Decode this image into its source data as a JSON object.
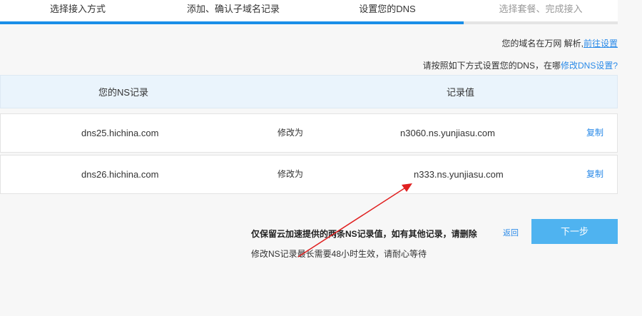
{
  "steps": [
    {
      "label": "选择接入方式",
      "state": "done"
    },
    {
      "label": "添加、确认子域名记录",
      "state": "done"
    },
    {
      "label": "设置您的DNS",
      "state": "current"
    },
    {
      "label": "选择套餐、完成接入",
      "state": "pending"
    }
  ],
  "progress": {
    "completed_steps": 3,
    "total_steps": 4,
    "color": "#1a8ee8"
  },
  "info": {
    "registrar_text": "您的域名在万网 解析,",
    "registrar_link": "前往设置",
    "instruction_text": "请按照如下方式设置您的DNS，在哪",
    "instruction_link": "修改DNS设置?"
  },
  "table": {
    "headers": {
      "ns": "您的NS记录",
      "value": "记录值"
    },
    "rows": [
      {
        "ns": "dns25.hichina.com",
        "action": "修改为",
        "value": "n3060.ns.yunjiasu.com",
        "copy": "复制"
      },
      {
        "ns": "dns26.hichina.com",
        "action": "修改为",
        "value": "n333.ns.yunjiasu.com",
        "copy": "复制"
      }
    ]
  },
  "notes": {
    "bold": "仅保留云加速提供的两条NS记录值，如有其他记录，请删除",
    "normal": "修改NS记录最长需要48小时生效，请耐心等待"
  },
  "actions": {
    "back": "返回",
    "next": "下一步"
  },
  "colors": {
    "accent": "#1a8ee8",
    "link": "#2a8ae8",
    "button": "#4fb3f0",
    "annotation": "#e02020"
  }
}
